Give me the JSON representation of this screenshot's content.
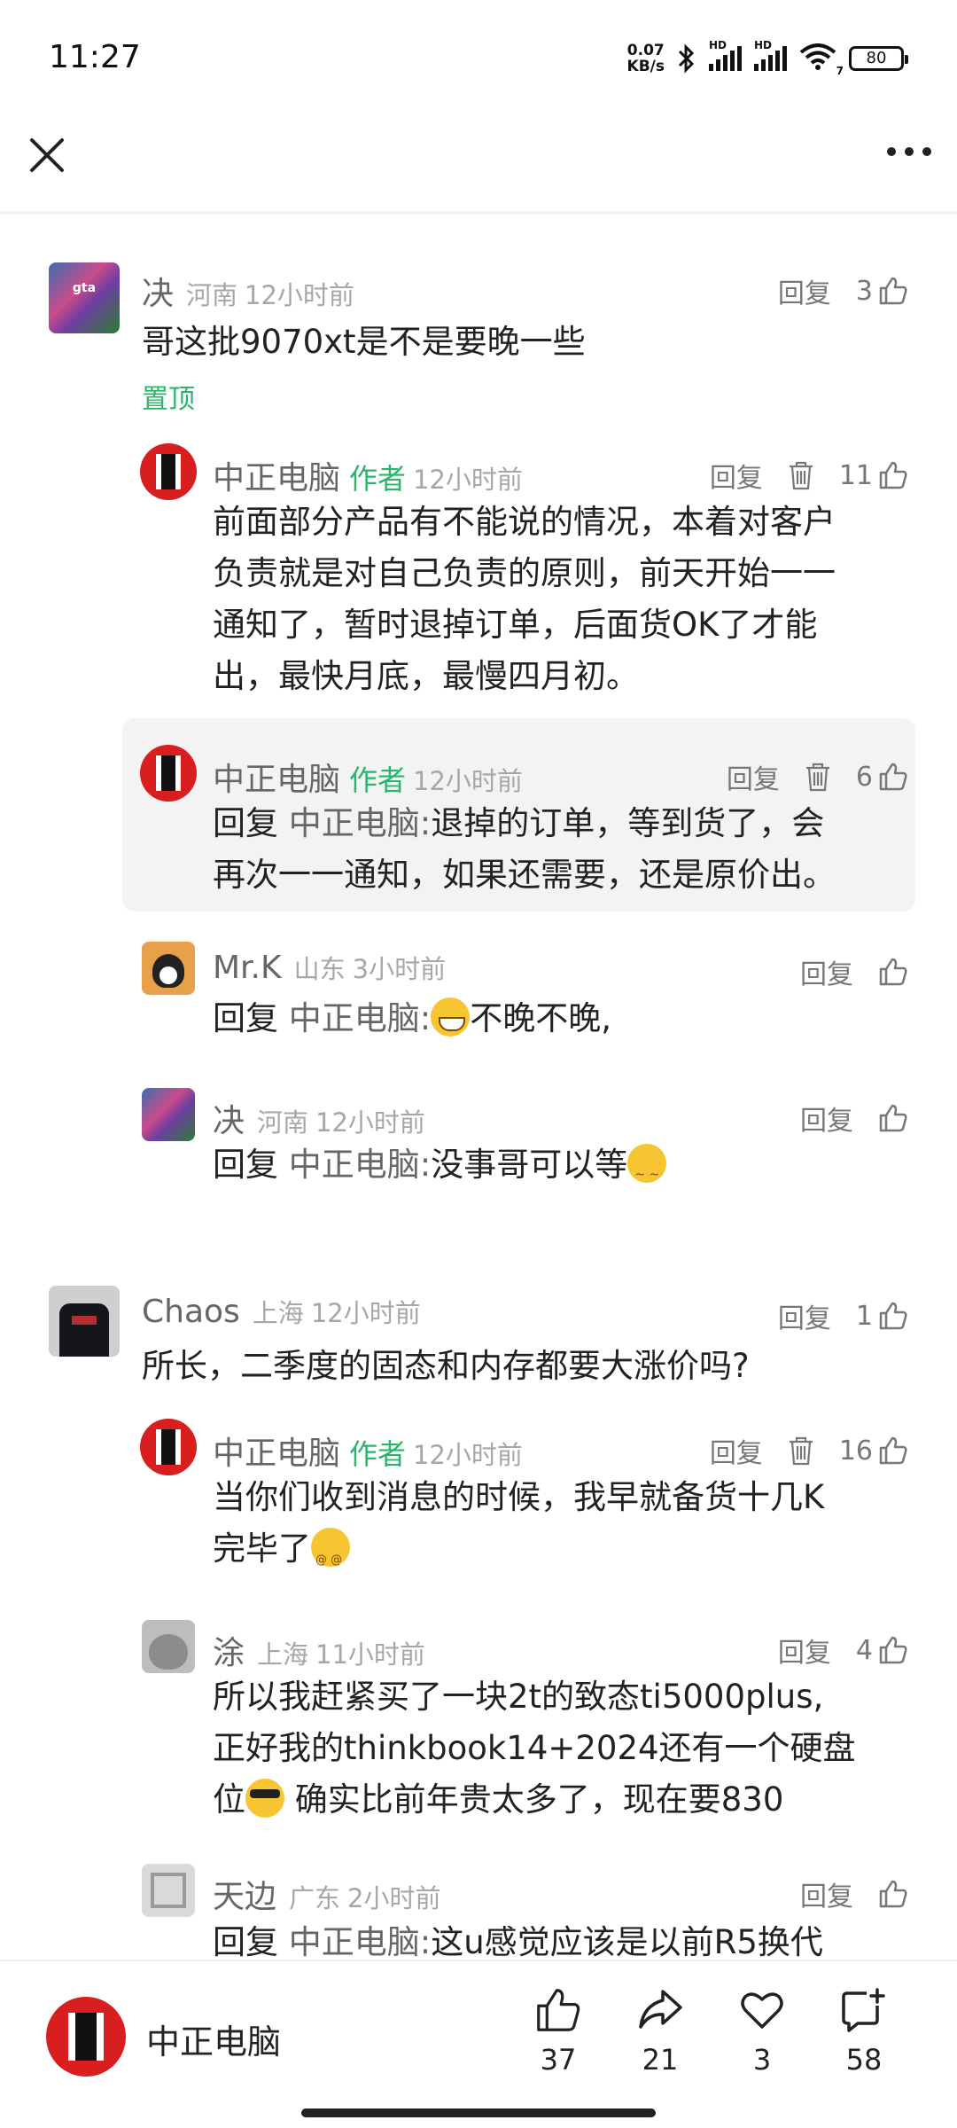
{
  "status": {
    "time": "11:27",
    "net_speed_value": "0.07",
    "net_speed_unit": "KB/s",
    "hd1": "HD",
    "hd2": "HD",
    "wifi_badge": "7",
    "battery": "80"
  },
  "comments": [
    {
      "name": "决",
      "location": "河南",
      "time": "12小时前",
      "text": "哥这批9070xt是不是要晚一些",
      "pinned": "置顶",
      "reply": "回复",
      "likes": "3"
    },
    {
      "name": "中正电脑",
      "tag": "作者",
      "time": "12小时前",
      "text_lines": [
        "前面部分产品有不能说的情况，本着对客户",
        "负责就是对自己负责的原则，前天开始一一",
        "通知了，暂时退掉订单，后面货OK了才能",
        "出，最快月底，最慢四月初。"
      ],
      "reply": "回复",
      "likes": "11"
    },
    {
      "name": "中正电脑",
      "tag": "作者",
      "time": "12小时前",
      "prefix": "回复",
      "target": "中正电脑:",
      "text_first": "退掉的订单，等到货了，会",
      "text_second": "再次一一通知，如果还需要，还是原价出。",
      "reply": "回复",
      "likes": "6"
    },
    {
      "name": "Mr.K",
      "location": "山东",
      "time": "3小时前",
      "prefix": "回复",
      "target": "中正电脑:",
      "text": "不晚不晚,",
      "reply": "回复"
    },
    {
      "name": "决",
      "location": "河南",
      "time": "12小时前",
      "prefix": "回复",
      "target": "中正电脑:",
      "text": "没事哥可以等",
      "reply": "回复"
    },
    {
      "name": "Chaos",
      "location": "上海",
      "time": "12小时前",
      "text": "所长，二季度的固态和内存都要大涨价吗?",
      "reply": "回复",
      "likes": "1"
    },
    {
      "name": "中正电脑",
      "tag": "作者",
      "time": "12小时前",
      "text_lines": [
        "当你们收到消息的时候，我早就备货十几K",
        "完毕了"
      ],
      "reply": "回复",
      "likes": "16"
    },
    {
      "name": "涂",
      "location": "上海",
      "time": "11小时前",
      "text_lines": [
        "所以我赶紧买了一块2t的致态ti5000plus,",
        "正好我的thinkbook14+2024还有一个硬盘"
      ],
      "text_last_a": "位",
      "text_last_b": " 确实比前年贵太多了，现在要830",
      "reply": "回复",
      "likes": "4"
    },
    {
      "name": "天边",
      "location": "广东",
      "time": "2小时前",
      "prefix": "回复",
      "target": "中正电脑:",
      "text": "这u感觉应该是以前R5换代",
      "reply": "回复"
    }
  ],
  "bottom": {
    "author": "中正电脑",
    "likes": "37",
    "shares": "21",
    "favorites": "3",
    "comments": "58"
  }
}
